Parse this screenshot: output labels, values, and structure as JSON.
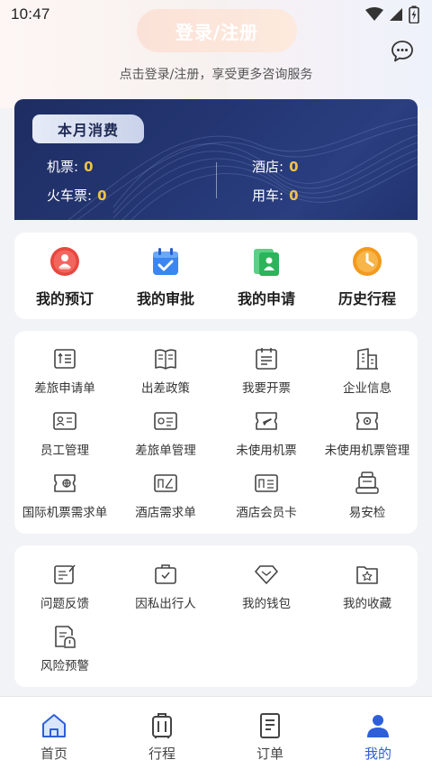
{
  "status_bar": {
    "time": "10:47"
  },
  "header": {
    "login_label": "登录/注册",
    "login_hint": "点击登录/注册，享受更多咨询服务",
    "chat_icon": "chat-bubble-icon"
  },
  "expense": {
    "title": "本月消费",
    "items": [
      {
        "label": "机票:",
        "value": "0"
      },
      {
        "label": "酒店:",
        "value": "0"
      },
      {
        "label": "火车票:",
        "value": "0"
      },
      {
        "label": "用车:",
        "value": "0"
      }
    ]
  },
  "quick_actions": [
    {
      "label": "我的预订",
      "icon": "booking-icon",
      "color": "#e8473f"
    },
    {
      "label": "我的审批",
      "icon": "approval-calendar-icon",
      "color": "#3b86f0"
    },
    {
      "label": "我的申请",
      "icon": "application-doc-icon",
      "color": "#2bb45a"
    },
    {
      "label": "历史行程",
      "icon": "history-clock-icon",
      "color": "#f39a1c"
    }
  ],
  "services": [
    {
      "label": "差旅申请单",
      "icon": "travel-request-icon"
    },
    {
      "label": "出差政策",
      "icon": "policy-book-icon"
    },
    {
      "label": "我要开票",
      "icon": "invoice-icon"
    },
    {
      "label": "企业信息",
      "icon": "building-icon"
    },
    {
      "label": "员工管理",
      "icon": "employee-card-icon"
    },
    {
      "label": "差旅单管理",
      "icon": "travel-order-manage-icon"
    },
    {
      "label": "未使用机票",
      "icon": "unused-ticket-icon"
    },
    {
      "label": "未使用机票管理",
      "icon": "unused-ticket-manage-icon"
    },
    {
      "label": "国际机票需求单",
      "icon": "intl-ticket-request-icon"
    },
    {
      "label": "酒店需求单",
      "icon": "hotel-request-icon"
    },
    {
      "label": "酒店会员卡",
      "icon": "hotel-member-card-icon"
    },
    {
      "label": "易安检",
      "icon": "security-check-icon"
    }
  ],
  "tools": [
    {
      "label": "问题反馈",
      "icon": "feedback-icon"
    },
    {
      "label": "因私出行人",
      "icon": "private-traveler-icon"
    },
    {
      "label": "我的钱包",
      "icon": "wallet-icon"
    },
    {
      "label": "我的收藏",
      "icon": "favorites-folder-icon"
    },
    {
      "label": "风险预警",
      "icon": "risk-warning-icon"
    }
  ],
  "tabbar": [
    {
      "label": "首页",
      "icon": "home-icon"
    },
    {
      "label": "行程",
      "icon": "luggage-icon"
    },
    {
      "label": "订单",
      "icon": "order-doc-icon"
    },
    {
      "label": "我的",
      "icon": "profile-icon",
      "active": true
    }
  ],
  "colors": {
    "accent": "#2e5fd9",
    "card_dark": "#243673",
    "value_gold": "#f4c148"
  }
}
